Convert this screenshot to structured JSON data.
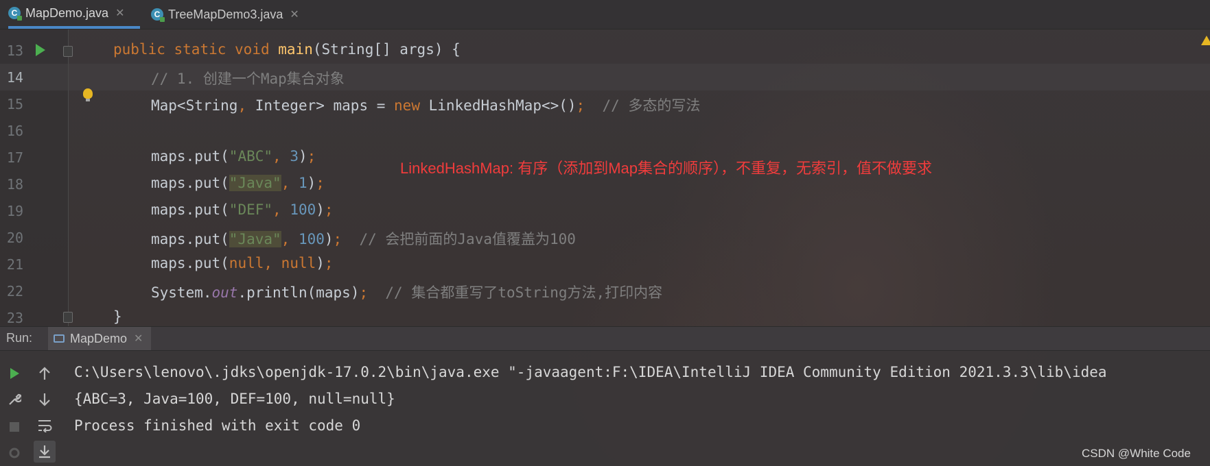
{
  "tabs": [
    {
      "label": "MapDemo.java",
      "icon": "java-class-icon",
      "active": true
    },
    {
      "label": "TreeMapDemo3.java",
      "icon": "java-class-icon",
      "active": false
    }
  ],
  "editor": {
    "lines": [
      {
        "num": "13"
      },
      {
        "num": "14"
      },
      {
        "num": "15"
      },
      {
        "num": "16"
      },
      {
        "num": "17"
      },
      {
        "num": "18"
      },
      {
        "num": "19"
      },
      {
        "num": "20"
      },
      {
        "num": "21"
      },
      {
        "num": "22"
      },
      {
        "num": "23"
      }
    ],
    "code": {
      "l13": {
        "public": "public",
        "static": "static",
        "void": "void",
        "main": "main",
        "rest": "(String[] args) {"
      },
      "l14": {
        "comment": "// 1. 创建一个Map集合对象"
      },
      "l15": {
        "a": "Map<String",
        "comma": ",",
        "b": " Integer> maps = ",
        "new": "new",
        "c": " LinkedHashMap<>()",
        "semi": ";",
        "comment": "  // 多态的写法"
      },
      "l17": {
        "a": "maps.put(",
        "s": "\"ABC\"",
        "comma": ",",
        "n": " 3",
        "b": ")",
        "semi": ";"
      },
      "l18": {
        "a": "maps.put(",
        "s": "\"Java\"",
        "comma": ",",
        "n": " 1",
        "b": ")",
        "semi": ";"
      },
      "l19": {
        "a": "maps.put(",
        "s": "\"DEF\"",
        "comma": ",",
        "n": " 100",
        "b": ")",
        "semi": ";"
      },
      "l20": {
        "a": "maps.put(",
        "s": "\"Java\"",
        "comma": ",",
        "n": " 100",
        "b": ")",
        "semi": ";",
        "comment": "  // 会把前面的Java值覆盖为100"
      },
      "l21": {
        "a": "maps.put(",
        "k1": "null",
        "comma": ",",
        "k2": " null",
        "b": ")",
        "semi": ";"
      },
      "l22": {
        "a": "System.",
        "out": "out",
        "b": ".println(maps)",
        "semi": ";",
        "comment": "  // 集合都重写了toString方法,打印内容"
      },
      "l23": {
        "a": "}"
      }
    }
  },
  "annotation": "LinkedHashMap: 有序（添加到Map集合的顺序），不重复，无索引，值不做要求",
  "run": {
    "label": "Run:",
    "tab": "MapDemo",
    "console": [
      "C:\\Users\\lenovo\\.jdks\\openjdk-17.0.2\\bin\\java.exe \"-javaagent:F:\\IDEA\\IntelliJ IDEA Community Edition 2021.3.3\\lib\\idea",
      "{ABC=3, Java=100, DEF=100, null=null}",
      "",
      "Process finished with exit code 0"
    ]
  },
  "watermark": "CSDN @White Code",
  "colors": {
    "keyword": "#cc7832",
    "string": "#6a8759",
    "number": "#6897bb",
    "comment": "#7f7f7f",
    "annotation": "#f03c3c",
    "accent": "#4a88c7"
  }
}
